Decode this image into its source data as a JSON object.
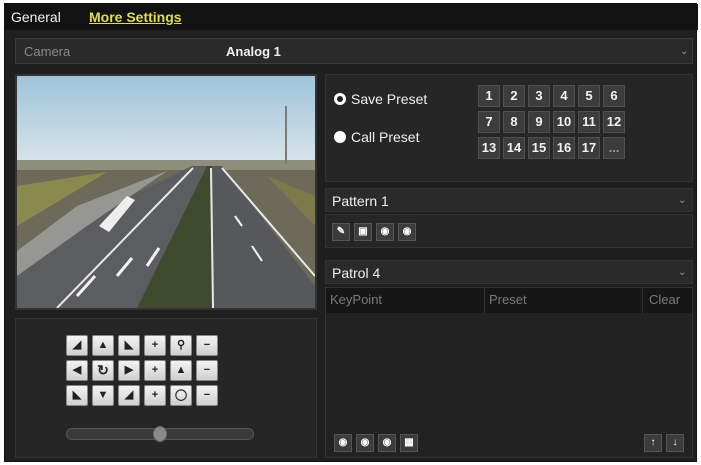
{
  "tabs": {
    "general": "General",
    "more_settings": "More Settings"
  },
  "camera": {
    "label": "Camera",
    "value": "Analog 1"
  },
  "preset": {
    "save_label": "Save Preset",
    "call_label": "Call Preset",
    "selected": "save",
    "numbers": [
      "1",
      "2",
      "3",
      "4",
      "5",
      "6",
      "7",
      "8",
      "9",
      "10",
      "11",
      "12",
      "13",
      "14",
      "15",
      "16",
      "17",
      "..."
    ]
  },
  "pattern": {
    "title": "Pattern 1"
  },
  "patrol": {
    "title": "Patrol 4",
    "columns": {
      "keypoint": "KeyPoint",
      "preset": "Preset",
      "clear": "Clear"
    }
  },
  "colors": {
    "tab_active": "#e2df45",
    "panel_bg": "#1f1f1f"
  },
  "icons": {
    "ptz": [
      "arrow-up-left",
      "arrow-up",
      "arrow-up-right",
      "plus",
      "zoom",
      "minus",
      "arrow-left",
      "auto-scan",
      "arrow-right",
      "plus",
      "focus",
      "minus",
      "arrow-down-left",
      "arrow-down",
      "arrow-down-right",
      "plus",
      "iris",
      "minus"
    ],
    "pattern": [
      "edit-icon",
      "save-icon",
      "play-icon",
      "stop-icon"
    ],
    "patrol": [
      "play-icon",
      "stop-icon",
      "set-icon",
      "delete-icon",
      "move-up-icon",
      "move-down-icon"
    ]
  },
  "ptz_speed": 0.5
}
